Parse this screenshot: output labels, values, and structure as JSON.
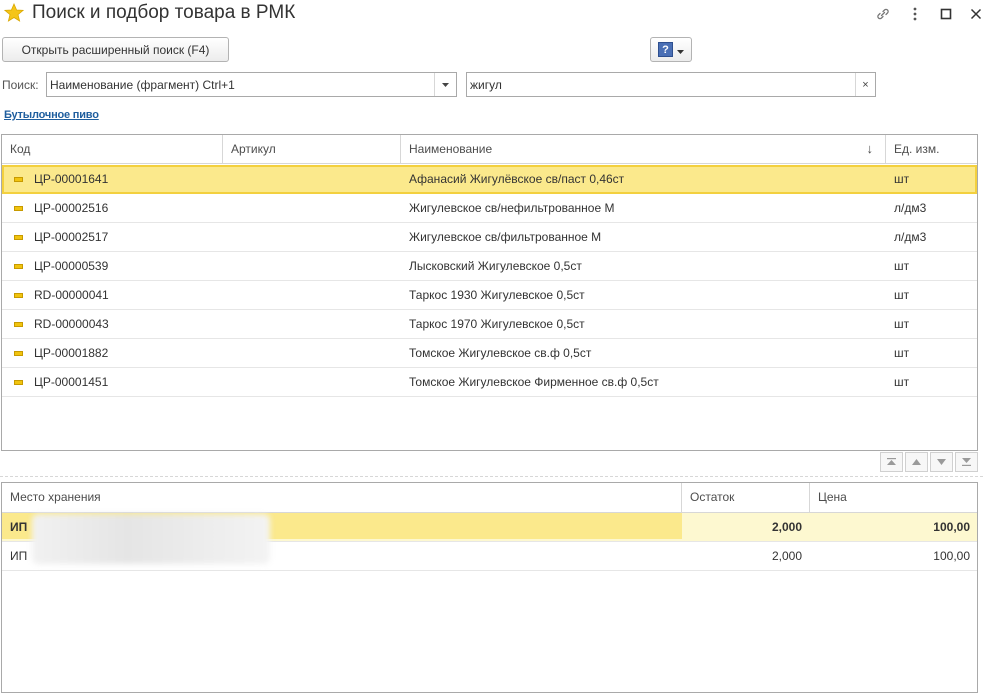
{
  "window": {
    "title": "Поиск и подбор товара в РМК"
  },
  "toolbar": {
    "advanced_search_label": "Открыть расширенный поиск (F4)",
    "help_label": "?"
  },
  "search": {
    "label": "Поиск:",
    "mode_value": "Наименование (фрагмент) Ctrl+1",
    "query_value": "жигул",
    "clear_label": "×"
  },
  "group_link": "Бутылочное пиво",
  "products": {
    "headers": {
      "code": "Код",
      "article": "Артикул",
      "name": "Наименование",
      "sort_indicator": "↓",
      "unit": "Ед. изм."
    },
    "rows": [
      {
        "code": "ЦР-00001641",
        "article": "",
        "name": "Афанасий Жигулёвское св/паст 0,46ст",
        "unit": "шт"
      },
      {
        "code": "ЦР-00002516",
        "article": "",
        "name": "Жигулевское св/нефильтрованное М",
        "unit": "л/дм3"
      },
      {
        "code": "ЦР-00002517",
        "article": "",
        "name": "Жигулевское св/фильтрованное М",
        "unit": "л/дм3"
      },
      {
        "code": "ЦР-00000539",
        "article": "",
        "name": "Лысковский Жигулевское 0,5ст",
        "unit": "шт"
      },
      {
        "code": "RD-00000041",
        "article": "",
        "name": "Таркос 1930 Жигулевское 0,5ст",
        "unit": "шт"
      },
      {
        "code": "RD-00000043",
        "article": "",
        "name": "Таркос 1970 Жигулевское 0,5ст",
        "unit": "шт"
      },
      {
        "code": "ЦР-00001882",
        "article": "",
        "name": "Томское Жигулевское св.ф 0,5ст",
        "unit": "шт"
      },
      {
        "code": "ЦР-00001451",
        "article": "",
        "name": "Томское Жигулевское Фирменное св.ф  0,5ст",
        "unit": "шт"
      }
    ]
  },
  "stock": {
    "headers": {
      "location": "Место хранения",
      "remainder": "Остаток",
      "price": "Цена"
    },
    "rows": [
      {
        "location": "ИП",
        "remainder": "2,000",
        "price": "100,00"
      },
      {
        "location": "ИП",
        "remainder": "2,000",
        "price": "100,00"
      }
    ]
  },
  "colors": {
    "selection": "#fbe98c",
    "selection_border": "#f3d03e",
    "star": "#f5c518",
    "link": "#1f5e9e"
  }
}
